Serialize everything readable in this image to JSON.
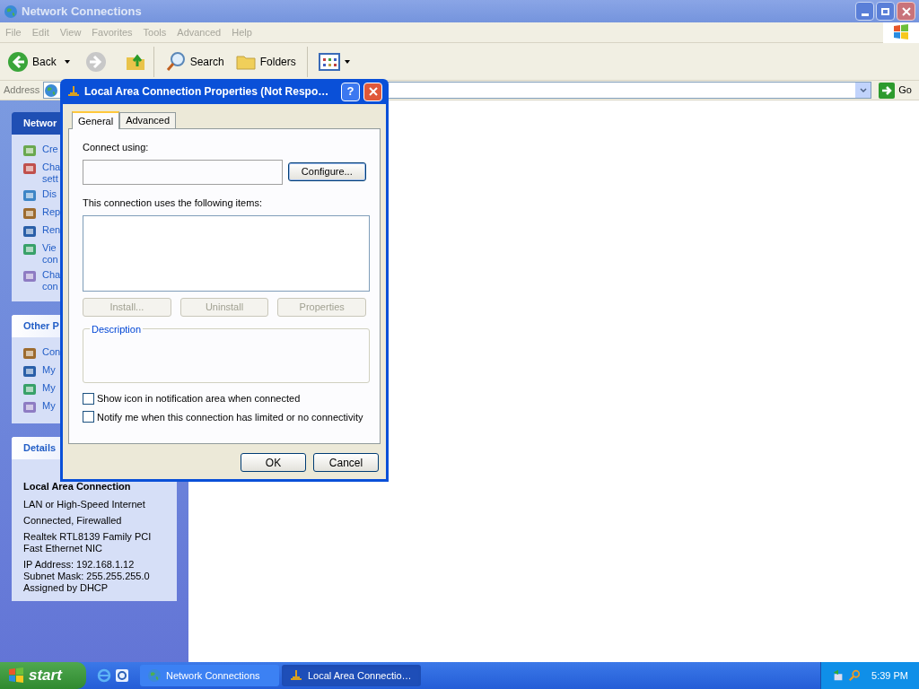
{
  "window": {
    "title": "Network Connections"
  },
  "menu": [
    {
      "label": "File",
      "disabled": true
    },
    {
      "label": "Edit",
      "disabled": true
    },
    {
      "label": "View",
      "disabled": true
    },
    {
      "label": "Favorites",
      "disabled": true
    },
    {
      "label": "Tools",
      "disabled": true
    },
    {
      "label": "Advanced",
      "disabled": true
    },
    {
      "label": "Help",
      "disabled": true
    }
  ],
  "toolbar": {
    "back": "Back",
    "search": "Search",
    "folders": "Folders"
  },
  "address": {
    "label": "Address",
    "go": "Go"
  },
  "sidebar": {
    "panels": [
      {
        "title": "Networ",
        "items": [
          "Cre",
          "Cha\nsett",
          "Dis",
          "Rep",
          "Ren",
          "Vie\ncon",
          "Cha\ncon"
        ]
      },
      {
        "title": "Other P",
        "items": [
          "Con",
          "My",
          "My",
          "My"
        ]
      }
    ],
    "details": {
      "title": "Details",
      "name": "Local Area Connection",
      "groups": [
        [
          "LAN or High-Speed Internet"
        ],
        [
          "Connected, Firewalled"
        ],
        [
          "Realtek RTL8139 Family PCI",
          "Fast Ethernet NIC"
        ],
        [
          "IP Address: 192.168.1.12",
          "Subnet Mask: 255.255.255.0",
          "Assigned by DHCP"
        ]
      ]
    }
  },
  "dialog": {
    "title": "Local Area Connection Properties (Not Respo…",
    "help": "?",
    "tabs": [
      {
        "label": "General",
        "selected": true
      },
      {
        "label": "Advanced",
        "selected": false
      }
    ],
    "connect_label": "Connect using:",
    "configure": "Configure...",
    "items_label": "This connection uses the following items:",
    "buttons": [
      {
        "label": "Install...",
        "disabled": true
      },
      {
        "label": "Uninstall",
        "disabled": true
      },
      {
        "label": "Properties",
        "disabled": true
      }
    ],
    "description": "Description",
    "checkboxes": [
      {
        "label": "Show icon in notification area when connected",
        "checked": false
      },
      {
        "label": "Notify me when this connection has limited or no connectivity",
        "checked": false
      }
    ],
    "footer": [
      "OK",
      "Cancel"
    ]
  },
  "taskbar": {
    "start": "start",
    "tasks": [
      {
        "label": "Network Connections",
        "selected": false
      },
      {
        "label": "Local Area Connectio…",
        "selected": true
      }
    ],
    "clock": "5:39 PM"
  }
}
